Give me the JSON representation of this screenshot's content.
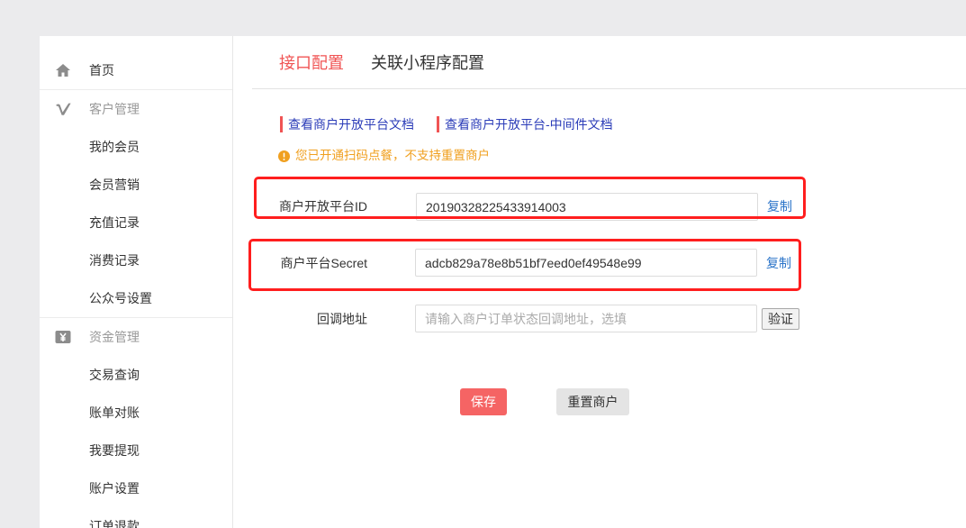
{
  "colors": {
    "accent": "#f05454",
    "link": "#2b3cb8",
    "copy_link": "#2b74c9",
    "notice": "#f0a020",
    "highlight": "#ff1e1e",
    "page_bg": "#ebebed",
    "primary_button": "#f56464",
    "secondary_button": "#e4e4e4"
  },
  "sidebar": {
    "home": {
      "label": "首页",
      "icon": "home-icon"
    },
    "groups": [
      {
        "title": "客户管理",
        "icon": "vimeo-icon",
        "items": [
          "我的会员",
          "会员营销",
          "充值记录",
          "消费记录",
          "公众号设置"
        ]
      },
      {
        "title": "资金管理",
        "icon": "yen-wallet-icon",
        "items": [
          "交易查询",
          "账单对账",
          "我要提现",
          "账户设置",
          "订单退款"
        ]
      }
    ]
  },
  "main": {
    "tabs": [
      {
        "label": "接口配置",
        "active": true
      },
      {
        "label": "关联小程序配置",
        "active": false
      }
    ],
    "doc_links": [
      "查看商户开放平台文档",
      "查看商户开放平台-中间件文档"
    ],
    "notice": {
      "icon": "warning-circle-icon",
      "text": "您已开通扫码点餐，不支持重置商户"
    },
    "form": {
      "merchant_id": {
        "label": "商户开放平台ID",
        "value": "20190328225433914003",
        "copy_label": "复制"
      },
      "secret": {
        "label": "商户平台Secret",
        "value": "adcb829a78e8b51bf7eed0ef49548e99",
        "copy_label": "复制"
      },
      "callback": {
        "label": "回调地址",
        "placeholder": "请输入商户订单状态回调地址，选填",
        "verify_label": "验证"
      }
    },
    "actions": {
      "save_label": "保存",
      "reset_label": "重置商户"
    }
  }
}
